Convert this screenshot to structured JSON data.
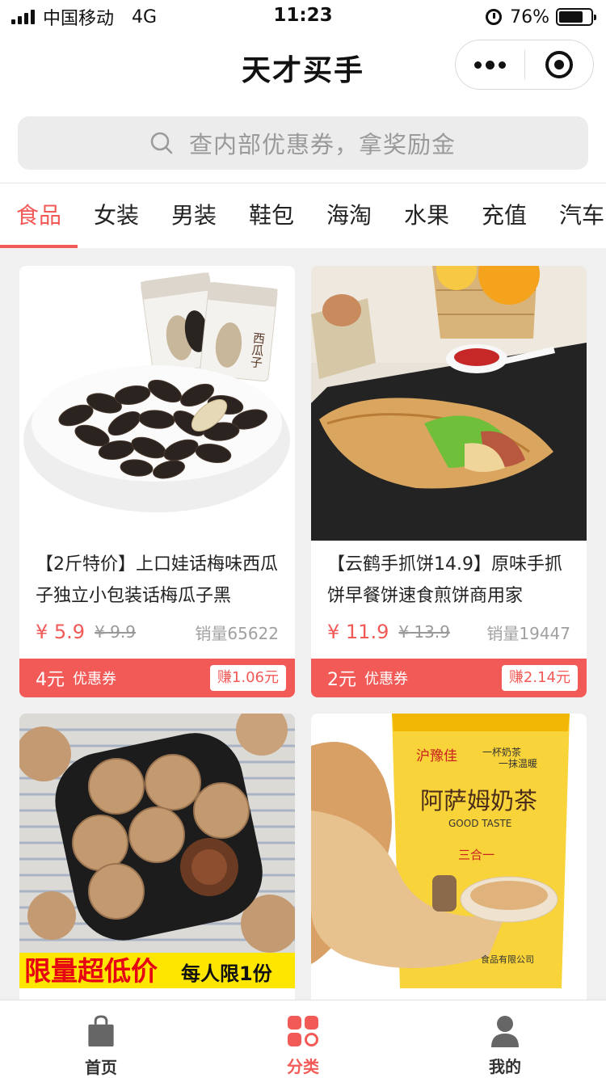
{
  "status_bar": {
    "carrier": "中国移动",
    "network": "4G",
    "time": "11:23",
    "battery": "76%",
    "battery_level": 0.76
  },
  "nav": {
    "title": "天才买手"
  },
  "search": {
    "placeholder": "查内部优惠券，拿奖励金"
  },
  "tabs": [
    "食品",
    "女装",
    "男装",
    "鞋包",
    "海淘",
    "水果",
    "充值",
    "汽车"
  ],
  "active_tab": "食品",
  "products": [
    {
      "title": "【2斤特价】上口娃话梅味西瓜子独立小包装话梅瓜子黑",
      "price": "¥ 5.9",
      "old_price": "¥ 9.9",
      "sales": "销量65622",
      "coupon_amount": "4元",
      "coupon_label": "优惠券",
      "earn": "赚1.06元",
      "package_text": "西瓜子"
    },
    {
      "title": "【云鹤手抓饼14.9】原味手抓饼早餐饼速食煎饼商用家",
      "price": "¥ 11.9",
      "old_price": "¥ 13.9",
      "sales": "销量19447",
      "coupon_amount": "2元",
      "coupon_label": "优惠券",
      "earn": "赚2.14元"
    },
    {
      "banner_big": "限量超低价",
      "banner_small": "每人限1份"
    },
    {
      "brand": "沪豫佳",
      "slogan_1": "一杯奶茶",
      "slogan_2": "一抹温暖",
      "product_name": "阿萨姆奶茶",
      "product_en": "GOOD TASTE",
      "subtitle": "三合一",
      "company": "食品有限公司"
    }
  ],
  "tabbar": [
    {
      "label": "首页",
      "icon": "shopping-bag-icon"
    },
    {
      "label": "分类",
      "icon": "category-grid-icon"
    },
    {
      "label": "我的",
      "icon": "user-icon"
    }
  ],
  "colors": {
    "accent": "#f25a57",
    "background": "#f0f0f0",
    "muted": "#999999"
  }
}
